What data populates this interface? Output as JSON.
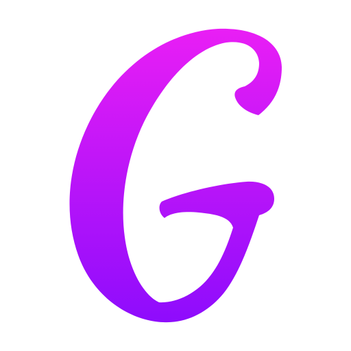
{
  "logo": {
    "icon": "script-letter-g-logo-icon",
    "lettering": "G",
    "gradient_top_color": "#e91ef5",
    "gradient_bottom_color": "#8e0cfc",
    "background_color": "#ffffff"
  }
}
